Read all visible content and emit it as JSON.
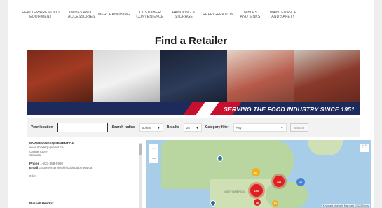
{
  "nav": {
    "items": [
      "Healthware Food Equipment",
      "Knives and Accessories",
      "Merchandising",
      "Customer Convenience",
      "Handling & Storage",
      "Refrigeration",
      "Tables and Sinks",
      "Maintenance and Safety"
    ]
  },
  "page_title": "Find a Retailer",
  "banner": {
    "tagline": "SERVING THE FOOD INDUSTRY SINCE 1951"
  },
  "filters": {
    "location_label": "Your location",
    "location_value": "",
    "radius_label": "Search radius",
    "radius_value": "50 km",
    "results_label": "Results",
    "results_value": "25",
    "category_label": "Category filter",
    "category_value": "Any",
    "search_button": "Search"
  },
  "retailers": [
    {
      "name": "WWW.IFOODEQUIPMENT.CA",
      "website": "www.ifoodequipment.ca",
      "type": "Online Store",
      "country": "Canada",
      "phone_label": "Phone",
      "phone": "1-833-888-0990",
      "email_label": "Email",
      "email": "customerservice@ifoodequipment.ca",
      "distance": "0 km"
    },
    {
      "name": "Russell Hendrix"
    }
  ],
  "map": {
    "clusters": [
      {
        "label": "62",
        "color": "#f2b01e"
      },
      {
        "label": "100",
        "color": "#e02020"
      },
      {
        "label": "111",
        "color": "#e02020"
      },
      {
        "label": "10",
        "color": "#e02020"
      },
      {
        "label": "40",
        "color": "#4a7fd6"
      },
      {
        "label": "10",
        "color": "#f2b01e"
      }
    ],
    "labels": [
      "NORTH AMERICA"
    ],
    "footer": "Keyboard shortcuts  Map data ©2023  Terms"
  }
}
